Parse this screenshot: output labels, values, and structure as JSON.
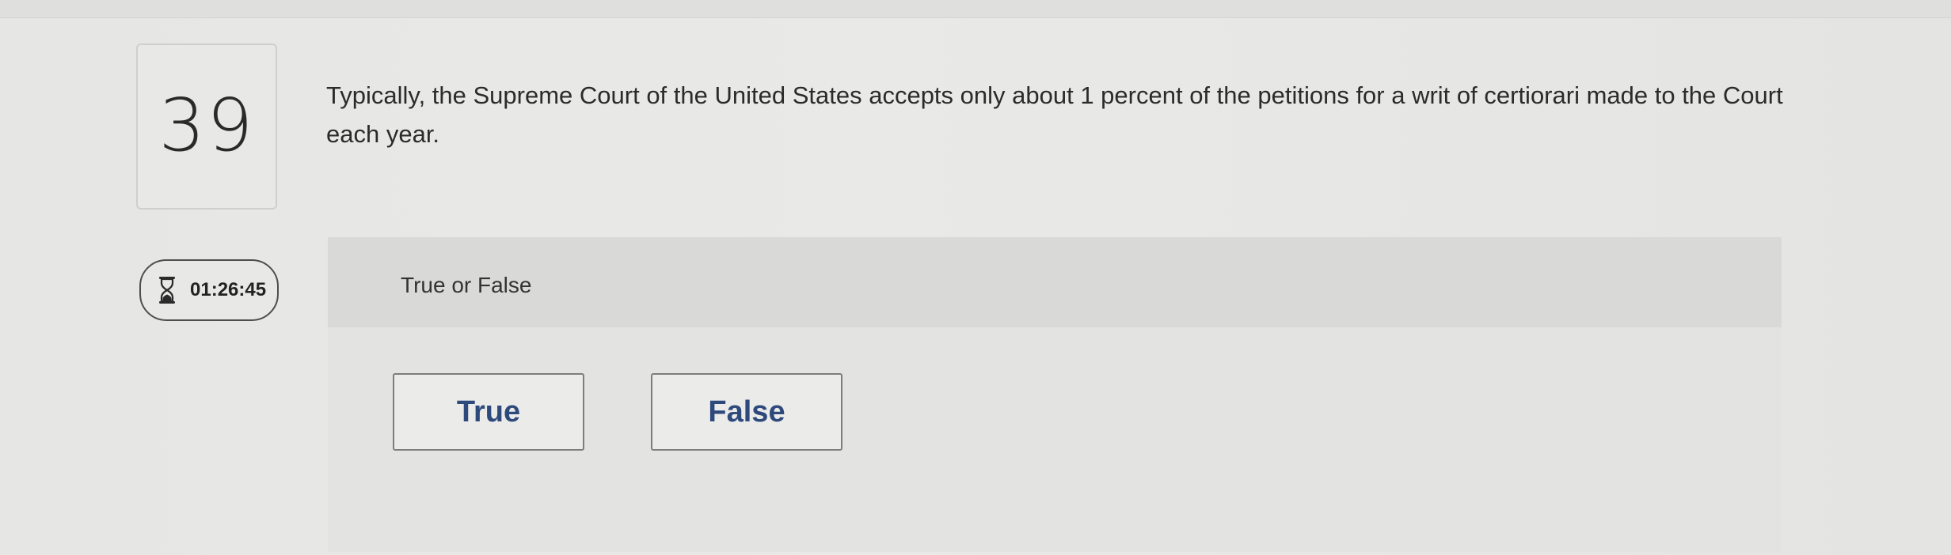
{
  "question": {
    "number": "39",
    "text": "Typically, the Supreme Court of the United States accepts only about 1 percent of the petitions for a writ of certiorari made to the Court each year."
  },
  "timer": {
    "icon": "hourglass-icon",
    "value": "01:26:45"
  },
  "answer": {
    "type_label": "True or False",
    "choices": [
      "True",
      "False"
    ]
  },
  "colors": {
    "choice_text": "#2e4a7d",
    "background": "#e8e8e6"
  }
}
